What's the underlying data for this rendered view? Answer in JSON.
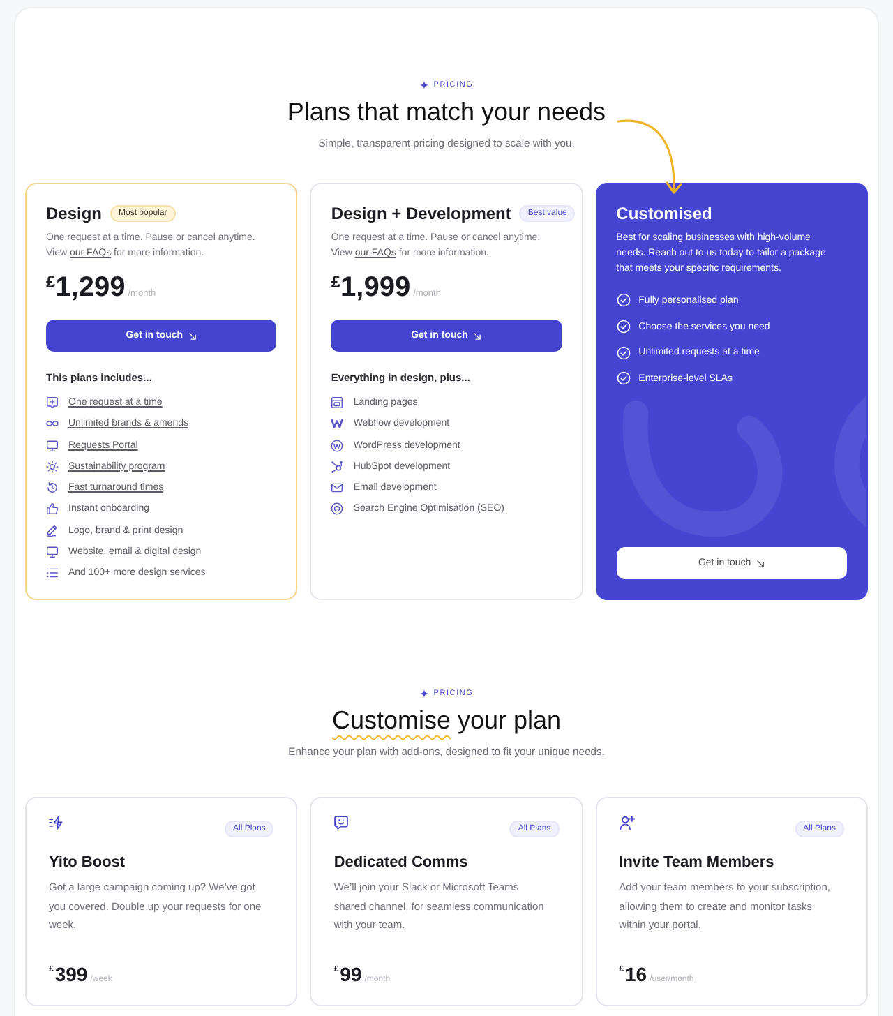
{
  "header": {
    "eyebrow": "PRICING",
    "title": "Plans that match your needs",
    "subtitle": "Simple, transparent pricing designed to scale with you."
  },
  "plans": [
    {
      "kind": "popular",
      "title": "Design",
      "badge": "Most popular",
      "description": "One request at a time. Pause or cancel anytime. View",
      "link": "our FAQs",
      "description_end": "for more information.",
      "currency": "£",
      "price": "1,299",
      "period": "/month",
      "button": "Get in touch",
      "features_heading": "This plans includes...",
      "features": [
        {
          "text": "One request at a time",
          "linked": true
        },
        {
          "text": "Unlimited brands & amends",
          "linked": true
        },
        {
          "text": "Requests Portal",
          "linked": true
        },
        {
          "text": "Sustainability program",
          "linked": true
        },
        {
          "text": "Fast turnaround times",
          "linked": true
        },
        {
          "text": "Instant onboarding",
          "linked": false
        },
        {
          "text": "Logo, brand & print design",
          "linked": false
        },
        {
          "text": "Website, email & digital design",
          "linked": false
        },
        {
          "text": "And 100+ more design services",
          "linked": false
        }
      ]
    },
    {
      "kind": "standard",
      "title": "Design + Development",
      "badge": "Best value",
      "description": "One request at a time. Pause or cancel anytime. View",
      "link": "our FAQs",
      "description_end": "for more information.",
      "currency": "£",
      "price": "1,999",
      "period": "/month",
      "button": "Get in touch",
      "features_heading": "Everything in design, plus...",
      "features": [
        {
          "text": "Landing pages",
          "linked": false
        },
        {
          "text": "Webflow development",
          "linked": false
        },
        {
          "text": "WordPress development",
          "linked": false
        },
        {
          "text": "HubSpot development",
          "linked": false
        },
        {
          "text": "Email development",
          "linked": false
        },
        {
          "text": "Search Engine Optimisation (SEO)",
          "linked": false
        }
      ]
    },
    {
      "kind": "custom",
      "title": "Customised",
      "description": "Best for scaling businesses with high-volume needs. Reach out to us today to tailor a package that meets your specific requirements.",
      "button": "Get in touch",
      "features": [
        {
          "text": "Fully personalised plan",
          "linked": false
        },
        {
          "text": "Choose the services you need",
          "linked": false
        },
        {
          "text": "Unlimited requests at a time",
          "linked": false
        },
        {
          "text": "Enterprise-level SLAs",
          "linked": false
        }
      ]
    }
  ],
  "addons_header": {
    "eyebrow": "PRICING",
    "title_highlight": "Customise",
    "title": "your plan",
    "subtitle": "Enhance your plan with add-ons, designed to fit your unique needs."
  },
  "addons": [
    {
      "title": "Yito Boost",
      "badge": "All Plans",
      "description": "Got a large campaign coming up? We’ve got you covered. Double up your requests for one week.",
      "currency": "£",
      "price": "399",
      "period": "/week"
    },
    {
      "title": "Dedicated Comms",
      "badge": "All Plans",
      "description": "We’ll join your Slack or Microsoft Teams shared channel, for seamless communication with your team.",
      "currency": "£",
      "price": "99",
      "period": "/month"
    },
    {
      "title": "Invite Team Members",
      "badge": "All Plans",
      "description": "Add your team members to your subscription, allowing them to create and monitor tasks within your portal.",
      "currency": "£",
      "price": "16",
      "period": "/user/month"
    }
  ]
}
